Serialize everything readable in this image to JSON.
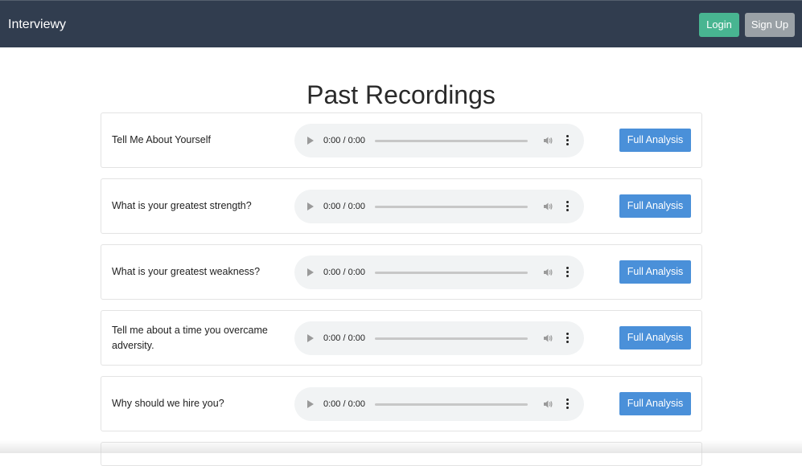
{
  "nav": {
    "brand": "Interviewy",
    "login_label": "Login",
    "signup_label": "Sign Up",
    "colors": {
      "bar": "#313d4f",
      "login": "#48b591",
      "signup": "#9aa1a6"
    }
  },
  "page": {
    "title": "Past Recordings"
  },
  "recordings": [
    {
      "question": "Tell Me About Yourself",
      "time": "0:00 / 0:00",
      "action_label": "Full Analysis"
    },
    {
      "question": "What is your greatest strength?",
      "time": "0:00 / 0:00",
      "action_label": "Full Analysis"
    },
    {
      "question": "What is your greatest weakness?",
      "time": "0:00 / 0:00",
      "action_label": "Full Analysis"
    },
    {
      "question": "Tell me about a time you overcame adversity.",
      "time": "0:00 / 0:00",
      "action_label": "Full Analysis"
    },
    {
      "question": "Why should we hire you?",
      "time": "0:00 / 0:00",
      "action_label": "Full Analysis"
    }
  ],
  "icons": {
    "play": "play-icon",
    "volume": "volume-icon",
    "more": "more-vertical-icon"
  },
  "accent": "#4a90d9"
}
